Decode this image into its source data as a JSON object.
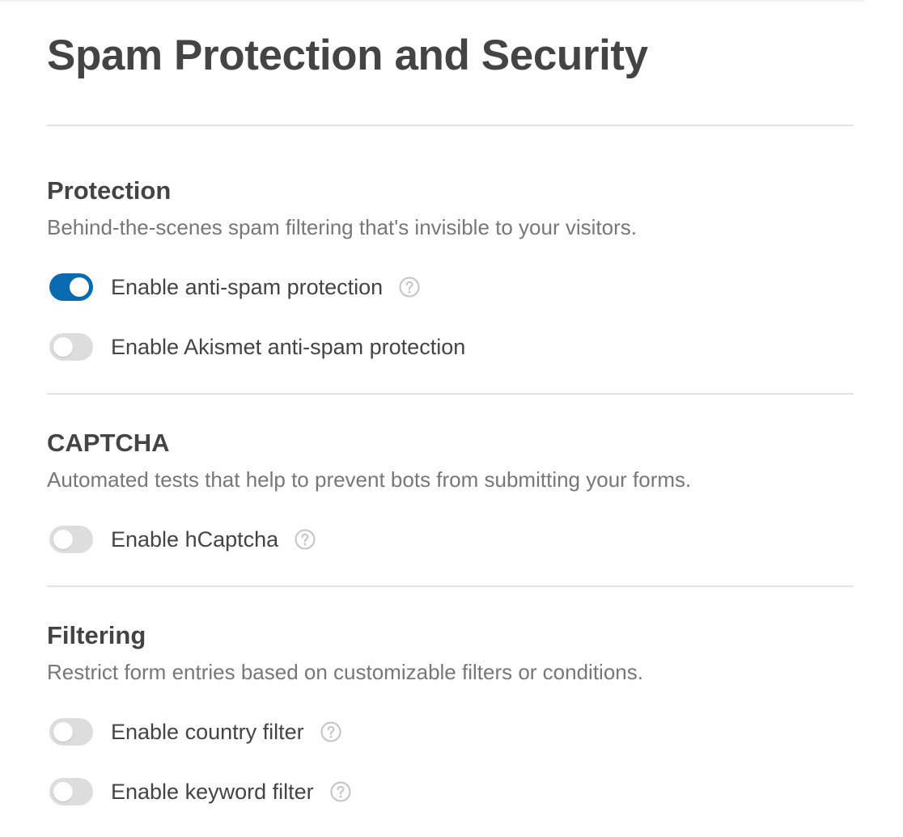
{
  "page": {
    "title": "Spam Protection and Security"
  },
  "sections": [
    {
      "heading": "Protection",
      "description": "Behind-the-scenes spam filtering that's invisible to your visitors.",
      "toggles": [
        {
          "label": "Enable anti-spam protection",
          "enabled": true,
          "help_icon": "question-circle-icon"
        },
        {
          "label": "Enable Akismet anti-spam protection",
          "enabled": false,
          "help_icon": ""
        }
      ]
    },
    {
      "heading": "CAPTCHA",
      "description": "Automated tests that help to prevent bots from submitting your forms.",
      "toggles": [
        {
          "label": "Enable hCaptcha",
          "enabled": false,
          "help_icon": "question-circle-icon"
        }
      ]
    },
    {
      "heading": "Filtering",
      "description": "Restrict form entries based on customizable filters or conditions.",
      "toggles": [
        {
          "label": "Enable country filter",
          "enabled": false,
          "help_icon": "question-circle-icon"
        },
        {
          "label": "Enable keyword filter",
          "enabled": false,
          "help_icon": "question-circle-icon"
        }
      ]
    }
  ],
  "colors": {
    "toggle_on": "#0a6bb1",
    "toggle_off": "#dddddd",
    "heading_text": "#444444",
    "description_text": "#777777",
    "divider": "#e3e3e3",
    "help_icon": "#c4c4c4"
  }
}
